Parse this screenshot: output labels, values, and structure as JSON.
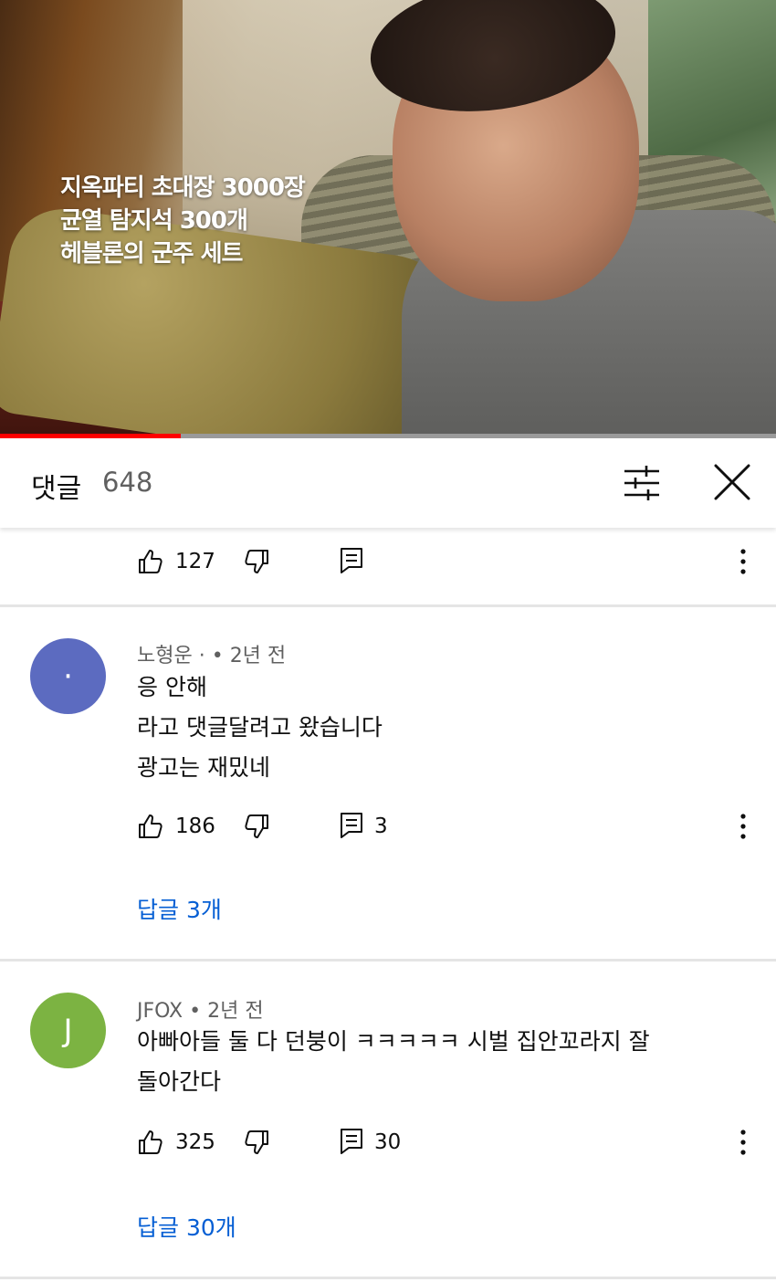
{
  "video": {
    "overlay_lines": [
      "지옥파티 초대장 3000장",
      "균열 탐지석 300개",
      "헤블론의 군주 세트"
    ],
    "progress_percent": 23.3,
    "progress_color": "#ff0000"
  },
  "comments_panel": {
    "title": "댓글",
    "count": "648",
    "filter_icon": "sliders-icon",
    "close_icon": "close-icon"
  },
  "comments": [
    {
      "partial": true,
      "likes": "127",
      "replies_count": ""
    },
    {
      "author": "노형운 ·",
      "time": "• 2년 전",
      "avatar_letter": "·",
      "avatar_color": "#5c6bc0",
      "lines": [
        "응 안해",
        "라고 댓글달려고 왔습니다",
        "광고는 재밌네"
      ],
      "likes": "186",
      "replies_count": "3",
      "replies_link": "답글 3개"
    },
    {
      "author": "JFOX",
      "time": "• 2년 전",
      "avatar_letter": "J",
      "avatar_color": "#7cb342",
      "lines": [
        "아빠아들 둘 다 던붕이 ㅋㅋㅋㅋㅋ 시벌 집안꼬라지 잘",
        "돌아간다"
      ],
      "likes": "325",
      "replies_count": "30",
      "replies_link": "답글 30개"
    }
  ],
  "colors": {
    "link": "#065fd4",
    "secondary_text": "#606060",
    "divider": "#e5e5e5"
  }
}
